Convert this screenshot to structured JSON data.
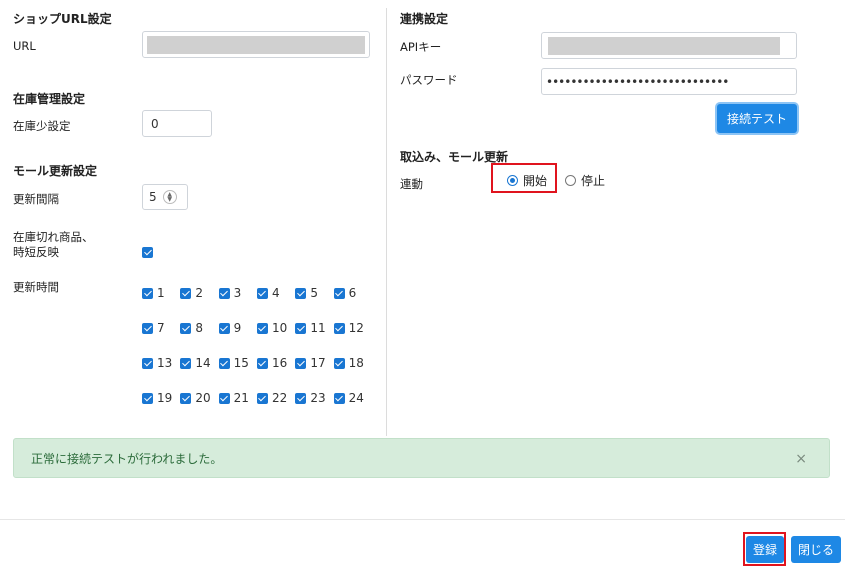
{
  "shop_url": {
    "title": "ショップURL設定",
    "label": "URL"
  },
  "stock": {
    "title": "在庫管理設定",
    "label": "在庫少設定",
    "value": "0"
  },
  "mall": {
    "title": "モール更新設定",
    "interval_label": "更新間隔",
    "interval_value": "5",
    "out_of_stock_label_1": "在庫切れ商品、",
    "out_of_stock_label_2": "時短反映",
    "hours_label": "更新時間",
    "hours": [
      "1",
      "2",
      "3",
      "4",
      "5",
      "6",
      "7",
      "8",
      "9",
      "10",
      "11",
      "12",
      "13",
      "14",
      "15",
      "16",
      "17",
      "18",
      "19",
      "20",
      "21",
      "22",
      "23",
      "24"
    ]
  },
  "integration": {
    "title": "連携設定",
    "api_key_label": "APIキー",
    "password_label": "パスワード",
    "password_mask": "••••••••••••••••••••••••••••••",
    "test_button": "接続テスト"
  },
  "import": {
    "title": "取込み、モール更新",
    "link_label": "連動",
    "start_label": "開始",
    "stop_label": "停止"
  },
  "alert": {
    "message": "正常に接続テストが行われました。",
    "close": "×"
  },
  "footer": {
    "register": "登録",
    "close": "閉じる"
  },
  "colors": {
    "accent": "#1e88e5",
    "highlight": "#e0141e",
    "success_bg": "#d6ecdb"
  }
}
